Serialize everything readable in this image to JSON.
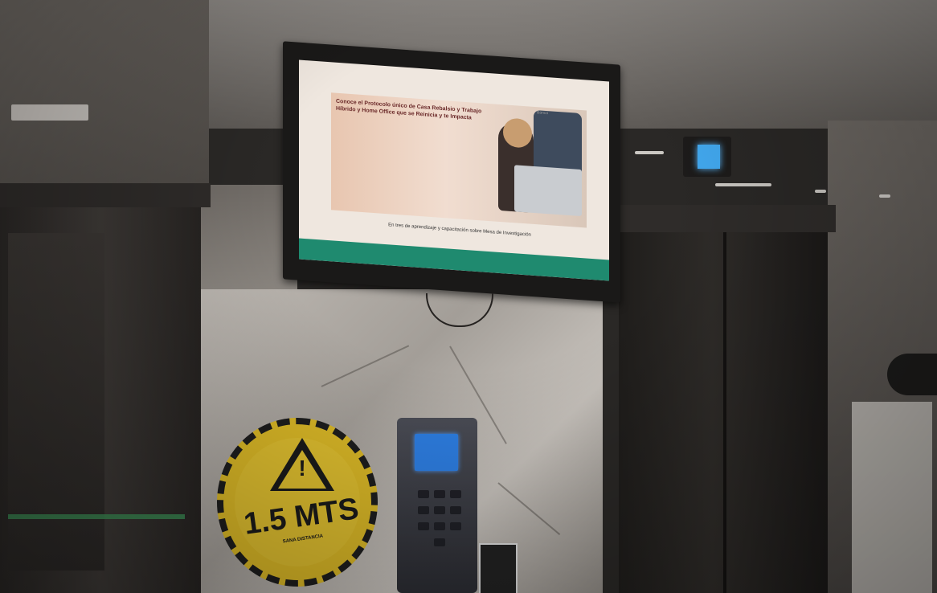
{
  "tv": {
    "headline": "Conoce el Protocolo único de Casa Rebalsio y Trabajo Híbrido y Home Office que se Reinicia y te Impacta",
    "caption": "En tres de aprendizaje y capacitación sobre Mesa de Investigación",
    "logo": "Banco"
  },
  "sign": {
    "distance": "1.5 MTS",
    "subtext": "SANA DISTANCIA"
  },
  "colors": {
    "screen_green": "#1f8a6f",
    "sign_yellow": "#d8b626",
    "indicator_blue": "#42a9f0",
    "reader_screen": "#2d7de0"
  }
}
